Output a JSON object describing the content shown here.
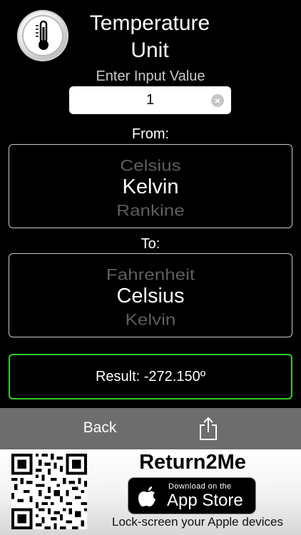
{
  "header": {
    "title_line1": "Temperature",
    "title_line2": "Unit",
    "app_icon": "thermometer-icon"
  },
  "input": {
    "label": "Enter Input Value",
    "value": "1",
    "clear_icon": "clear-circle-icon"
  },
  "from": {
    "label": "From:",
    "prev": "Celsius",
    "selected": "Kelvin",
    "next": "Rankine"
  },
  "to": {
    "label": "To:",
    "prev": "Fahrenheit",
    "selected": "Celsius",
    "next": "Kelvin"
  },
  "result": {
    "text": "Result: -272.150º"
  },
  "toolbar": {
    "back_label": "Back",
    "share_icon": "share-icon"
  },
  "ad": {
    "brand": "Return2Me",
    "store_small": "Download on the",
    "store_big": "App Store",
    "tagline": "Lock-screen your Apple devices",
    "accent": "#2ecc2e"
  }
}
